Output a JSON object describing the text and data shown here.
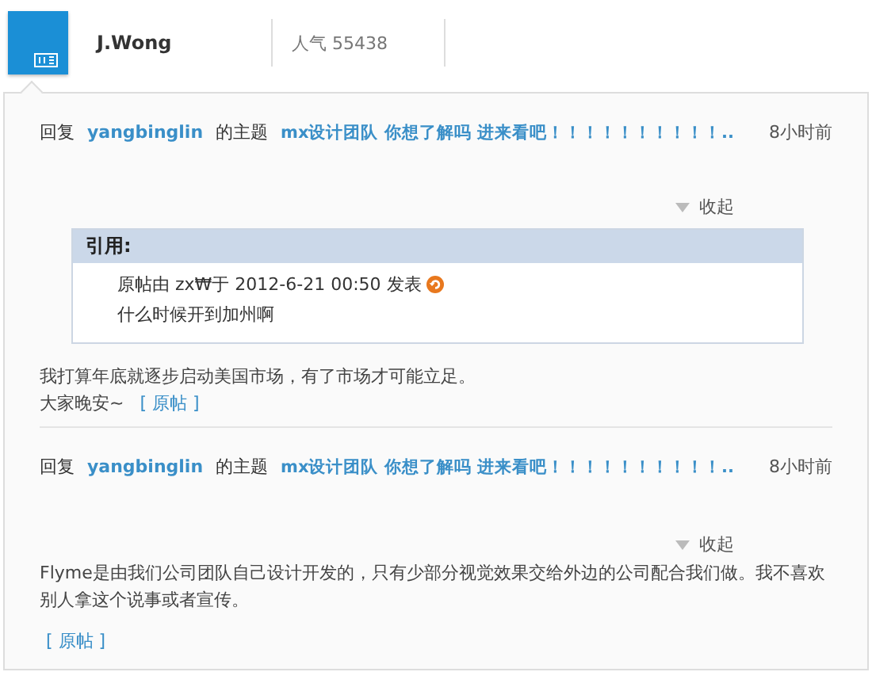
{
  "profile": {
    "name": "J.Wong",
    "popularity": "人气 55438"
  },
  "posts": [
    {
      "verb": "回复",
      "user": "yangbinglin",
      "of_topic": "的主题",
      "topic": "mx设计团队 你想了解吗 进来看吧！！！！！！！！！！..",
      "time": "8小时前",
      "collapse": "收起",
      "quote": {
        "title": "引用:",
        "meta": "原帖由 zx₩于 2012-6-21 00:50 发表",
        "text": "什么时候开到加州啊"
      },
      "body": [
        {
          "text": "我打算年底就逐步启动美国市场，有了市场才可能立足。"
        },
        {
          "text": "大家晚安~",
          "link": "[ 原帖 ]"
        }
      ]
    },
    {
      "verb": "回复",
      "user": "yangbinglin",
      "of_topic": "的主题",
      "topic": "mx设计团队 你想了解吗 进来看吧！！！！！！！！！！..",
      "time": "8小时前",
      "collapse": "收起",
      "body": [
        {
          "text": "Flyme是由我们公司团队自己设计开发的，只有少部分视觉效果交给外边的公司配合我们做。我不喜欢别人拿这个说事或者宣传。"
        },
        {
          "link": "[ 原帖 ]"
        }
      ]
    }
  ]
}
